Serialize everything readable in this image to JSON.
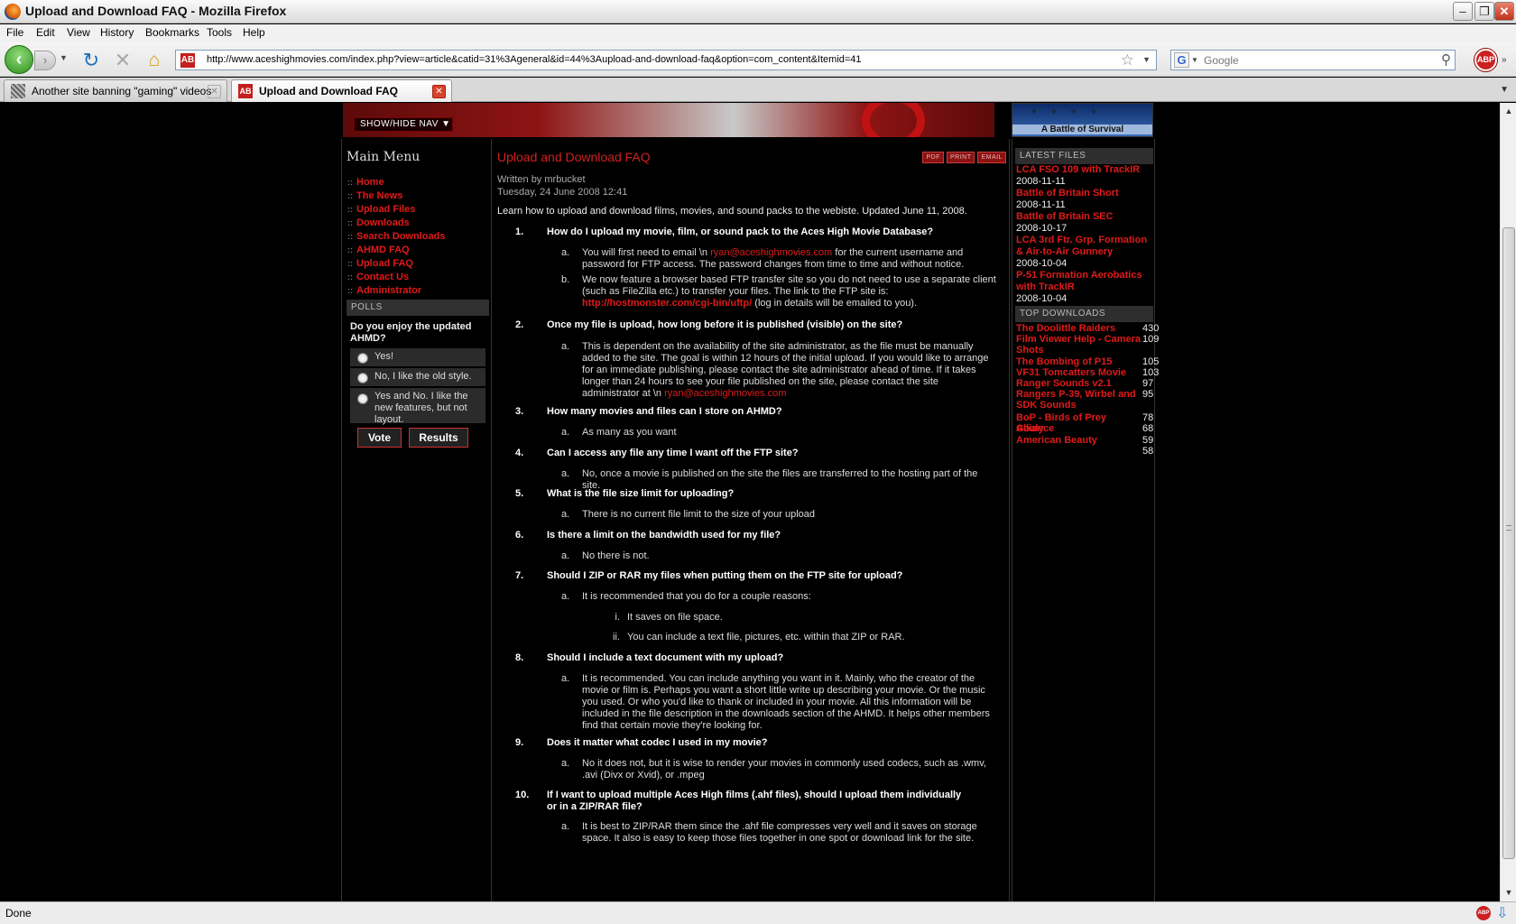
{
  "window": {
    "title": "Upload and Download FAQ - Mozilla Firefox"
  },
  "menu": [
    "File",
    "Edit",
    "View",
    "History",
    "Bookmarks",
    "Tools",
    "Help"
  ],
  "nav": {
    "url": "http://www.aceshighmovies.com/index.php?view=article&catid=31%3Ageneral&id=44%3Aupload-and-download-faq&option=com_content&Itemid=41",
    "search_placeholder": "Google",
    "abp_label": "ABP"
  },
  "tabs": [
    {
      "label": "Another site banning \"gaming\" videos"
    },
    {
      "label": "Upload and Download FAQ"
    }
  ],
  "banner": {
    "show_hide": "SHOW/HIDE NAV ▼",
    "right_banner": "A Battle of Survival"
  },
  "sidebar": {
    "title": "Main Menu",
    "items": [
      "Home",
      "The News",
      "Upload Files",
      "Downloads",
      "Search Downloads",
      "AHMD FAQ",
      "Upload FAQ",
      "Contact Us",
      "Administrator"
    ],
    "polls_head": "POLLS",
    "poll_question": "Do you enjoy the updated AHMD?",
    "poll_options": [
      "Yes!",
      "No, I like the old style.",
      "Yes and No. I like the new features, but not layout."
    ],
    "vote_label": "Vote",
    "results_label": "Results"
  },
  "article": {
    "title": "Upload and Download FAQ",
    "icons": [
      "PDF",
      "PRINT",
      "EMAIL"
    ],
    "author": "Written by mrbucket",
    "date": "Tuesday, 24 June 2008 12:41",
    "intro": "Learn how to upload and download films, movies, and sound packs to the webiste.  Updated June 11, 2008.",
    "questions": [
      {
        "num": "1.",
        "text": "How do I upload my movie, film, or sound pack to the Aces High Movie Database?"
      },
      {
        "num": "2.",
        "text": "Once my file is upload, how long before it is published (visible) on the site?"
      },
      {
        "num": "3.",
        "text": "How many movies and files can I store on AHMD?"
      },
      {
        "num": "4.",
        "text": "Can I access any file any time I want off the FTP site?"
      },
      {
        "num": "5.",
        "text": "What is the file size limit for uploading?"
      },
      {
        "num": "6.",
        "text": "Is there a limit on the bandwidth used for my file?"
      },
      {
        "num": "7.",
        "text": "Should I ZIP or RAR my files when putting them on the FTP site for upload?"
      },
      {
        "num": "8.",
        "text": "Should I include a text document with my upload?"
      },
      {
        "num": "9.",
        "text": "Does it matter what codec I used in my movie?"
      },
      {
        "num": "10.",
        "text": "If I want to upload multiple  Aces High films (.ahf files), should I upload them individually or in a ZIP/RAR file?"
      }
    ],
    "answers": {
      "q1a_pre": "You will first need to email \\n ",
      "q1a_link": "ryan@aceshighmovies.com",
      "q1a_post": " for the current username and password for FTP access.  The password changes from time to time and without notice.",
      "q1b_pre": "We now feature a browser based FTP transfer site so you do not need to use a separate client (such as FileZilla etc.) to transfer your files.  The link to the FTP site is: ",
      "q1b_link": "http://hostmonster.com/cgi-bin/uftp/",
      "q1b_post": " (log in details will be emailed to you).",
      "q2a_pre": "This is dependent on the availability of the site administrator, as the file must be manually added to the site.  The goal is within 12 hours of the initial upload.  If you would like to arrange for an immediate publishing, please contact the site administrator ahead of time.  If it takes longer than 24 hours to see your file published on the site, please contact the site administrator at \\n ",
      "q2a_link": "ryan@aceshighmovies.com",
      "q3a": "As many as you want",
      "q4a": "No, once a movie is published on the site the files are transferred to the hosting part of the site.",
      "q5a": "There is no current file limit to the size of your upload",
      "q6a": "No there is not.",
      "q7a": "It is recommended that you do for a couple reasons:",
      "q7i": "It saves on file space.",
      "q7ii": "You can include a text file, pictures, etc. within that ZIP or RAR.",
      "q8a": "It is recommended.  You can include anything you want in it.  Mainly, who the creator of the movie or film is.  Perhaps you want a short little write up describing your movie.  Or the music you used.  Or who you'd like to thank or included in your movie.  All this information will be included in the file description in the downloads section of the AHMD.  It helps other members find that certain movie they're looking for.",
      "q9a": "No it does not, but it is wise to render your movies in commonly used codecs, such as .wmv, .avi (Divx or Xvid), or .mpeg",
      "q10a": "It is best to ZIP/RAR them since the .ahf file compresses very well and it saves on storage space.  It also is easy to keep those files together in one spot or download link for the site."
    },
    "letters": {
      "a": "a.",
      "b": "b.",
      "i": "i.",
      "ii": "ii."
    }
  },
  "latest_files": {
    "head": "LATEST FILES",
    "items": [
      {
        "title": "LCA FSO 109 with TrackIR",
        "date": "2008-11-11"
      },
      {
        "title": "Battle of Britain Short",
        "date": "2008-11-11"
      },
      {
        "title": "Battle of Britain SEC",
        "date": "2008-10-17"
      },
      {
        "title": "LCA 3rd Ftr. Grp. Formation & Air-to-Air Gunnery",
        "date": "2008-10-04"
      },
      {
        "title": "P-51 Formation Aerobatics with TrackIR",
        "date": "2008-10-04"
      }
    ]
  },
  "top_downloads": {
    "head": "TOP DOWNLOADS",
    "items": [
      {
        "title": "The Doolittle Raiders",
        "count": "430"
      },
      {
        "title": "Film Viewer Help - Camera Shots",
        "count": "109"
      },
      {
        "title": "The Bombing of P15",
        "count": "105"
      },
      {
        "title": "VF31 Tomcatters Movie",
        "count": "103"
      },
      {
        "title": "Ranger Sounds v2.1",
        "count": "97"
      },
      {
        "title": "Rangers P-39, Wirbel and SDK Sounds",
        "count": "95"
      },
      {
        "title": "BoP - Birds of Prey Alliance",
        "count": "78"
      },
      {
        "title": "Goaly",
        "count": "68"
      },
      {
        "title": "American Beauty",
        "count": "59"
      },
      {
        "title": "",
        "count": "58"
      }
    ]
  },
  "status": {
    "text": "Done"
  }
}
